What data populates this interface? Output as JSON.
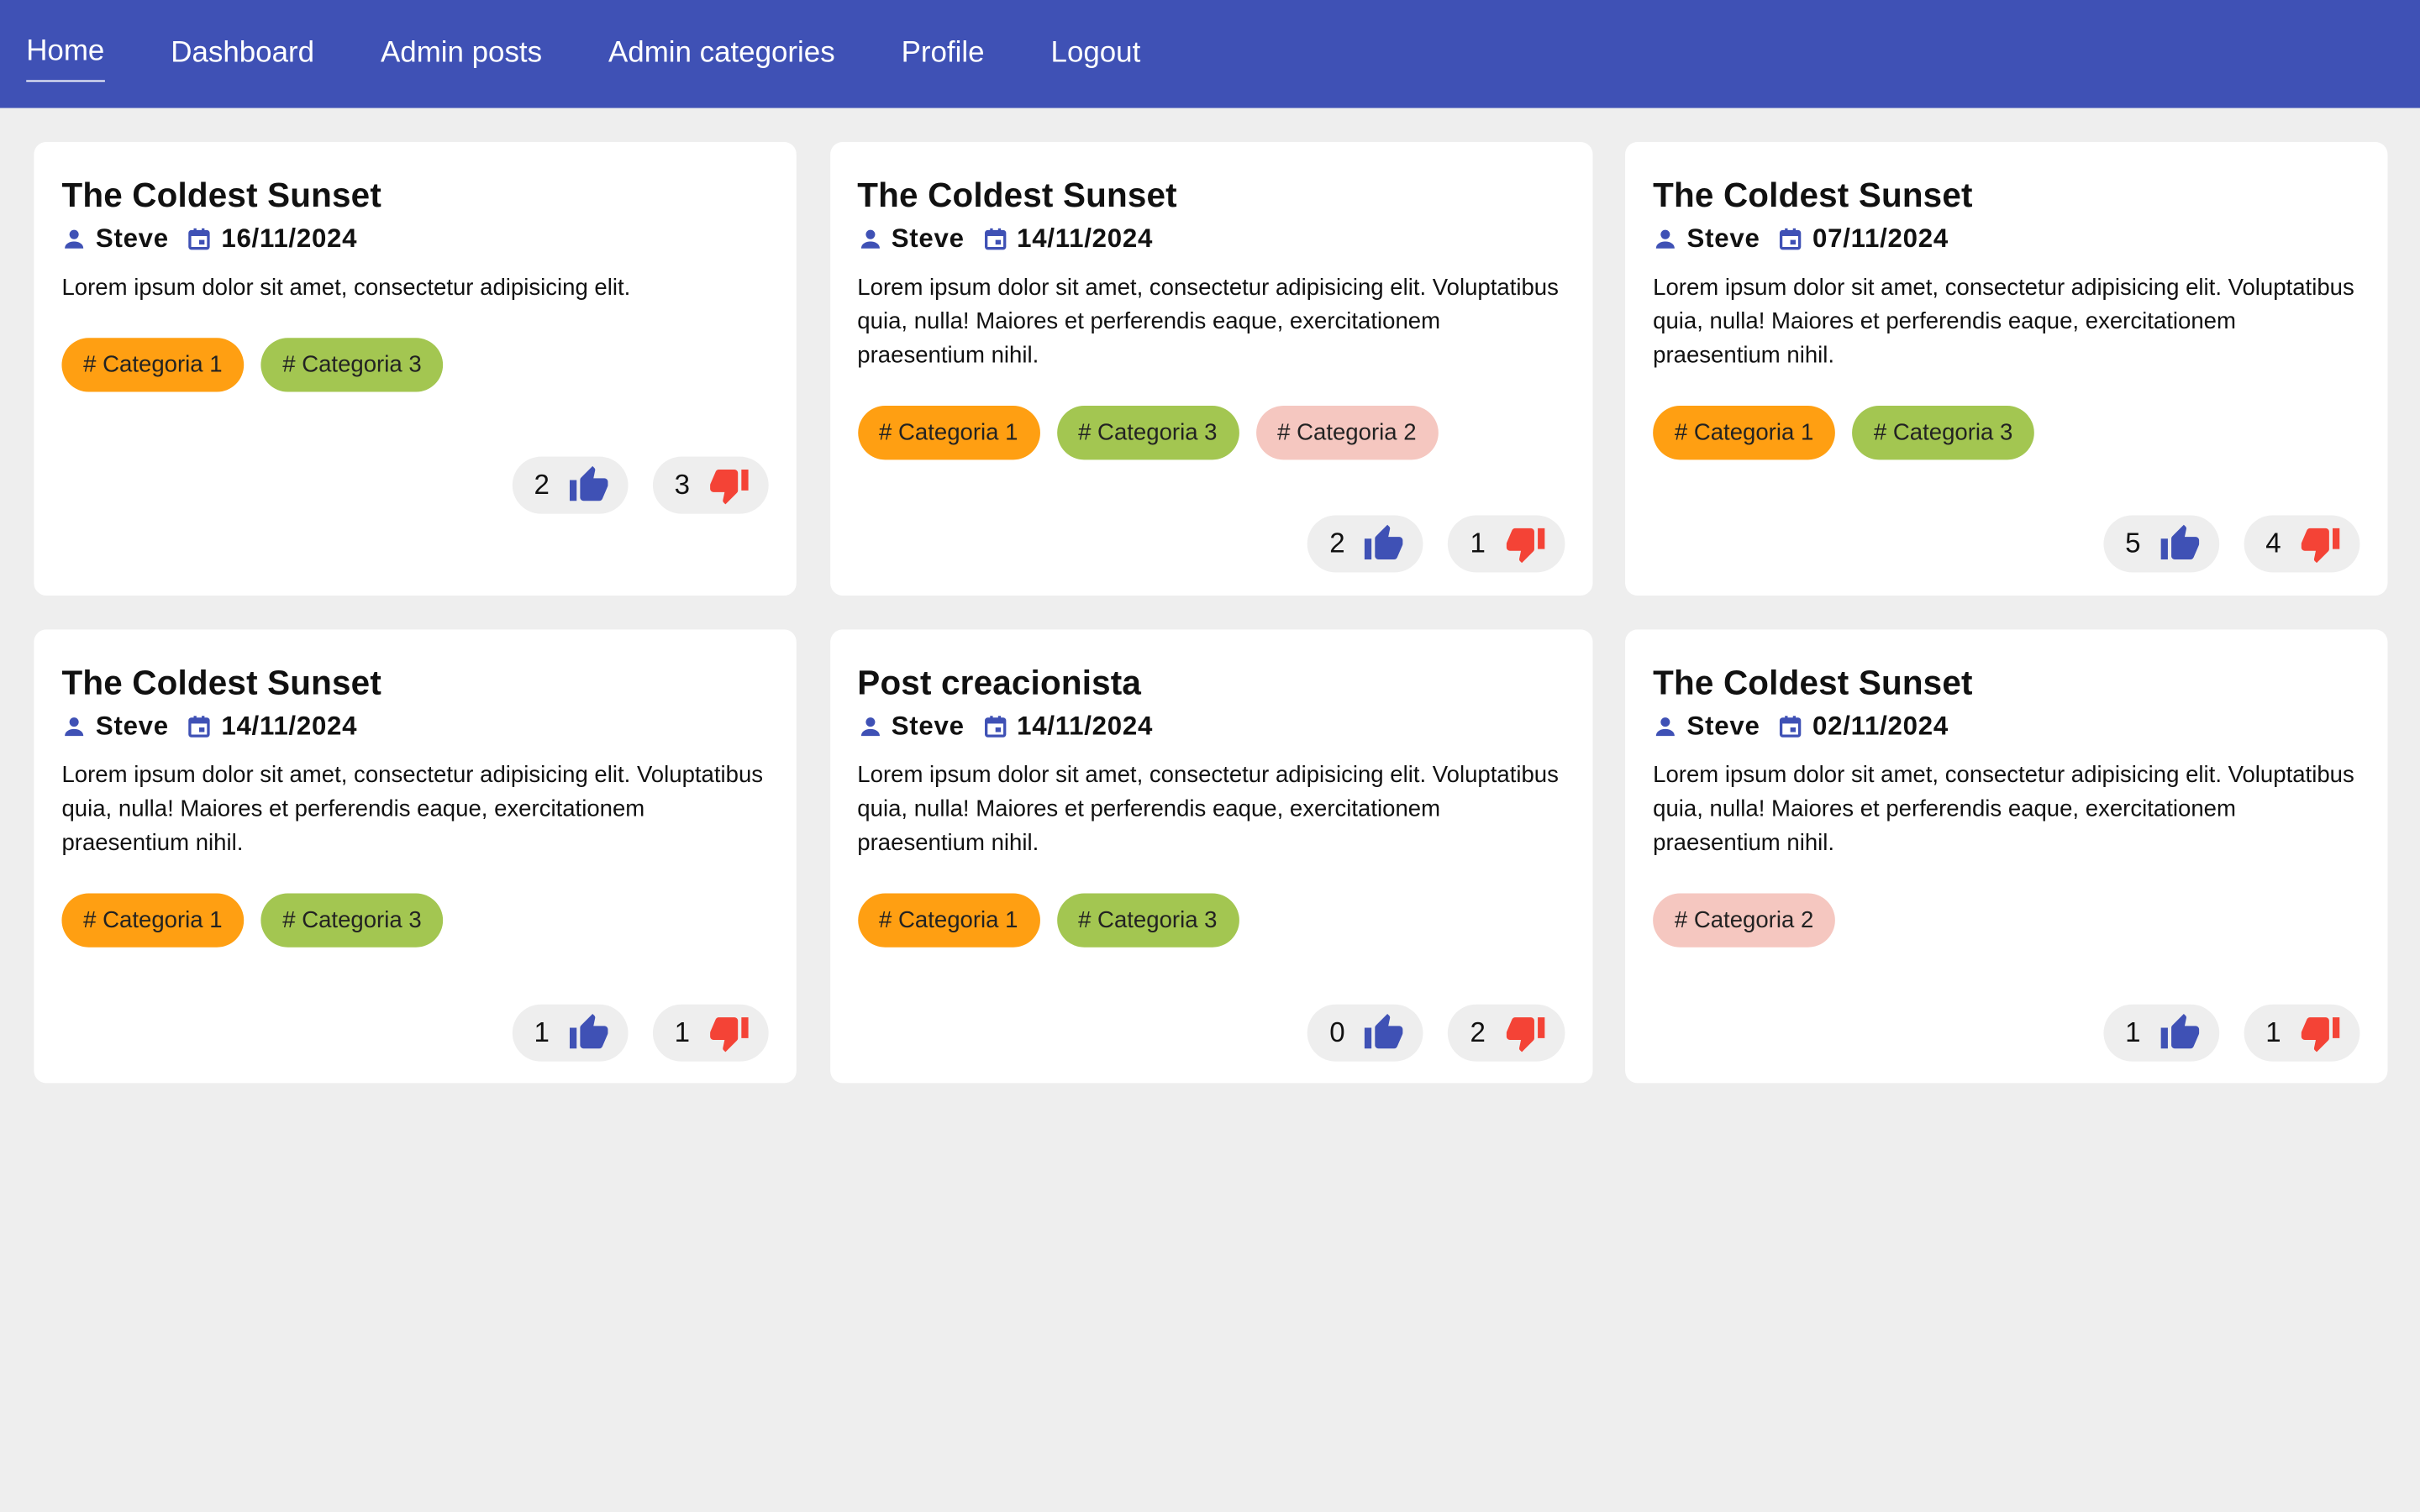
{
  "nav": {
    "items": [
      {
        "label": "Home",
        "active": true
      },
      {
        "label": "Dashboard",
        "active": false
      },
      {
        "label": "Admin posts",
        "active": false
      },
      {
        "label": "Admin categories",
        "active": false
      },
      {
        "label": "Profile",
        "active": false
      },
      {
        "label": "Logout",
        "active": false
      }
    ]
  },
  "colors": {
    "primary": "#3f51b5",
    "like": "#3f51b5",
    "dislike": "#f44336",
    "categoria_1": "#ff9f12",
    "categoria_3": "#a3c651",
    "categoria_2": "#f5c7c0"
  },
  "icons": {
    "author": "person-icon",
    "date": "calendar-icon",
    "like": "thumb-up-icon",
    "dislike": "thumb-down-icon"
  },
  "posts": [
    {
      "title": "The Coldest Sunset",
      "author": "Steve",
      "date": "16/11/2024",
      "body": "Lorem ipsum dolor sit amet, consectetur adipisicing elit.",
      "tags": [
        "# Categoria 1",
        "# Categoria 3"
      ],
      "likes": "2",
      "dislikes": "3"
    },
    {
      "title": "The Coldest Sunset",
      "author": "Steve",
      "date": "14/11/2024",
      "body": "Lorem ipsum dolor sit amet, consectetur adipisicing elit. Voluptatibus quia, nulla! Maiores et perferendis eaque, exercitationem praesentium nihil.",
      "tags": [
        "# Categoria 1",
        "# Categoria 3",
        "# Categoria 2"
      ],
      "likes": "2",
      "dislikes": "1"
    },
    {
      "title": "The Coldest Sunset",
      "author": "Steve",
      "date": "07/11/2024",
      "body": "Lorem ipsum dolor sit amet, consectetur adipisicing elit. Voluptatibus quia, nulla! Maiores et perferendis eaque, exercitationem praesentium nihil.",
      "tags": [
        "# Categoria 1",
        "# Categoria 3"
      ],
      "likes": "5",
      "dislikes": "4"
    },
    {
      "title": "The Coldest Sunset",
      "author": "Steve",
      "date": "14/11/2024",
      "body": "Lorem ipsum dolor sit amet, consectetur adipisicing elit. Voluptatibus quia, nulla! Maiores et perferendis eaque, exercitationem praesentium nihil.",
      "tags": [
        "# Categoria 1",
        "# Categoria 3"
      ],
      "likes": "1",
      "dislikes": "1"
    },
    {
      "title": "Post creacionista",
      "author": "Steve",
      "date": "14/11/2024",
      "body": "Lorem ipsum dolor sit amet, consectetur adipisicing elit. Voluptatibus quia, nulla! Maiores et perferendis eaque, exercitationem praesentium nihil.",
      "tags": [
        "# Categoria 1",
        "# Categoria 3"
      ],
      "likes": "0",
      "dislikes": "2"
    },
    {
      "title": "The Coldest Sunset",
      "author": "Steve",
      "date": "02/11/2024",
      "body": "Lorem ipsum dolor sit amet, consectetur adipisicing elit. Voluptatibus quia, nulla! Maiores et perferendis eaque, exercitationem praesentium nihil.",
      "tags": [
        "# Categoria 2"
      ],
      "likes": "1",
      "dislikes": "1"
    }
  ]
}
